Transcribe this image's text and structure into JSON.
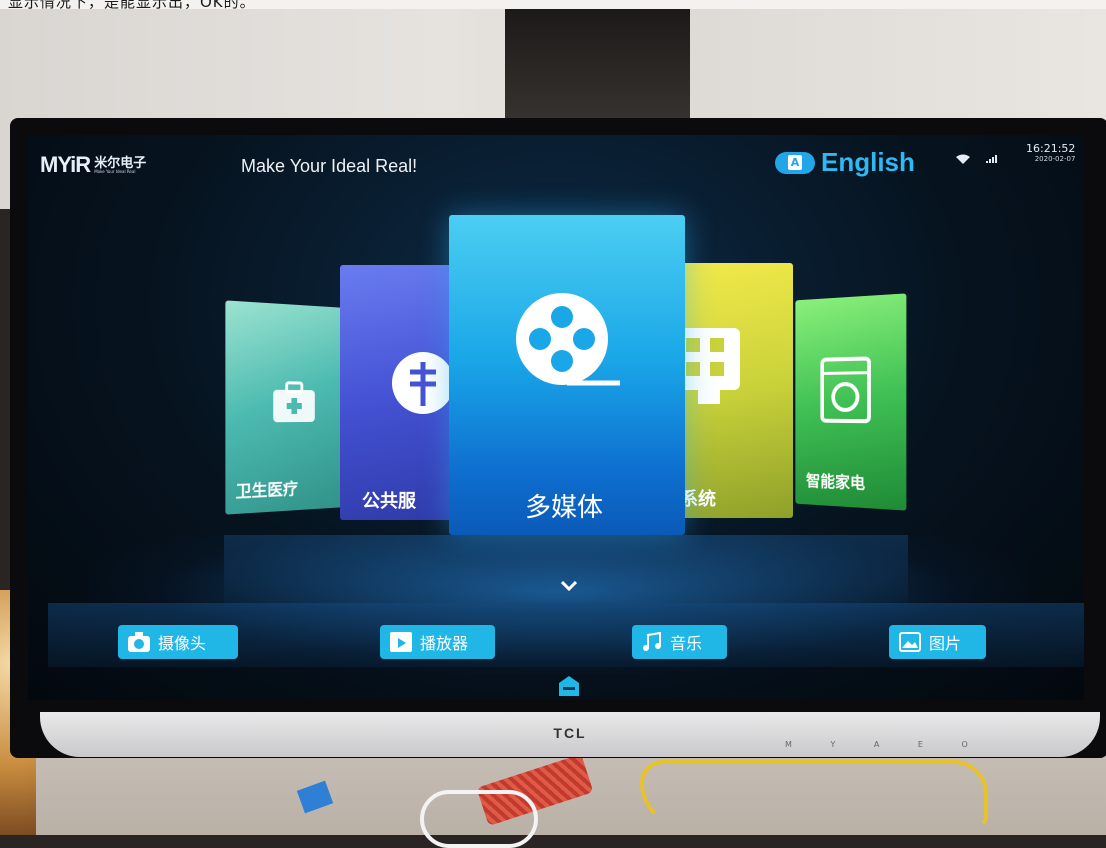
{
  "photo_caption": "显示情况下，是能显示出，OK的。",
  "header": {
    "logo_text": "MYiR",
    "logo_cn": "米尔电子",
    "logo_tagline": "Make Your Ideal Real",
    "slogan": "Make Your Ideal Real!",
    "language_label": "English",
    "language_icon": "translate-icon",
    "time": "16:21:52",
    "date": "2020-02-07"
  },
  "carousel": {
    "items": [
      {
        "label": "卫生医疗",
        "icon": "medical-kit-icon",
        "color": "#4cbab0"
      },
      {
        "label": "公共服",
        "icon": "public-service-icon",
        "color": "#4452d4"
      },
      {
        "label": "多媒体",
        "icon": "film-reel-icon",
        "color": "#1aa7e8",
        "selected": true
      },
      {
        "label": "系统",
        "icon": "apps-grid-icon",
        "color": "#c9d23a"
      },
      {
        "label": "智能家电",
        "icon": "washing-machine-icon",
        "color": "#3fc054"
      }
    ]
  },
  "dock": {
    "items": [
      {
        "label": "摄像头",
        "icon": "camera-icon"
      },
      {
        "label": "播放器",
        "icon": "video-player-icon"
      },
      {
        "label": "音乐",
        "icon": "music-note-icon"
      },
      {
        "label": "图片",
        "icon": "image-icon"
      }
    ]
  },
  "monitor": {
    "brand": "TCL",
    "buttons": "M Y A E O"
  },
  "colors": {
    "accent": "#20b6e6",
    "language": "#30b8f2"
  }
}
